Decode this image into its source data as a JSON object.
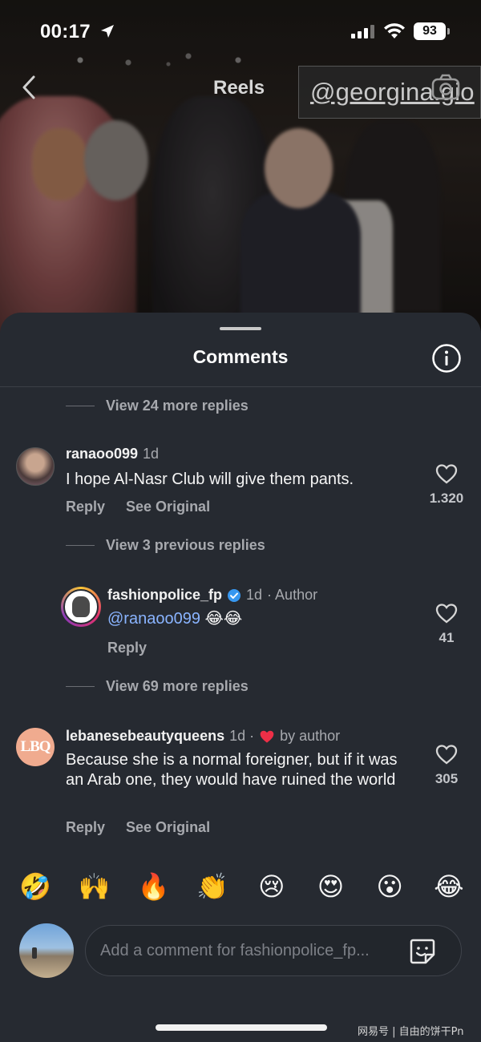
{
  "status_bar": {
    "time": "00:17",
    "battery": "93"
  },
  "header": {
    "title": "Reels",
    "watermark": "@georgina.gio"
  },
  "sheet": {
    "title": "Comments",
    "view_more_1": "View 24 more replies",
    "view_previous": "View 3 previous replies",
    "view_more_2": "View 69 more replies"
  },
  "comments": [
    {
      "username": "ranaoo099",
      "time": "1d",
      "text": "I hope Al-Nasr Club will give them pants.",
      "reply": "Reply",
      "see_original": "See Original",
      "likes": "1.320"
    },
    {
      "username": "fashionpolice_fp",
      "time": "1d",
      "author_label": "· Author",
      "mention": "@ranaoo099",
      "emojis": "😂😂",
      "reply": "Reply",
      "likes": "41"
    },
    {
      "username": "lebanesebeautyqueens",
      "time": "1d ·",
      "by_author": "by author",
      "avatar_text": "LBQ",
      "text": "Because she is a normal foreigner, but if it was an Arab one, they would have ruined the world",
      "reply": "Reply",
      "see_original": "See Original",
      "likes": "305"
    }
  ],
  "emoji_bar": [
    "🤣",
    "🙌",
    "🔥",
    "👏",
    "😢",
    "😍",
    "😮",
    "😂"
  ],
  "composer": {
    "placeholder": "Add a comment for fashionpolice_fp..."
  },
  "corner_watermark": "网易号 | 自由的饼干Pn",
  "colors": {
    "sheet_bg": "#262a31",
    "verified": "#3797f0",
    "heart_red": "#ed2f47",
    "mention": "#8ab4ff"
  }
}
